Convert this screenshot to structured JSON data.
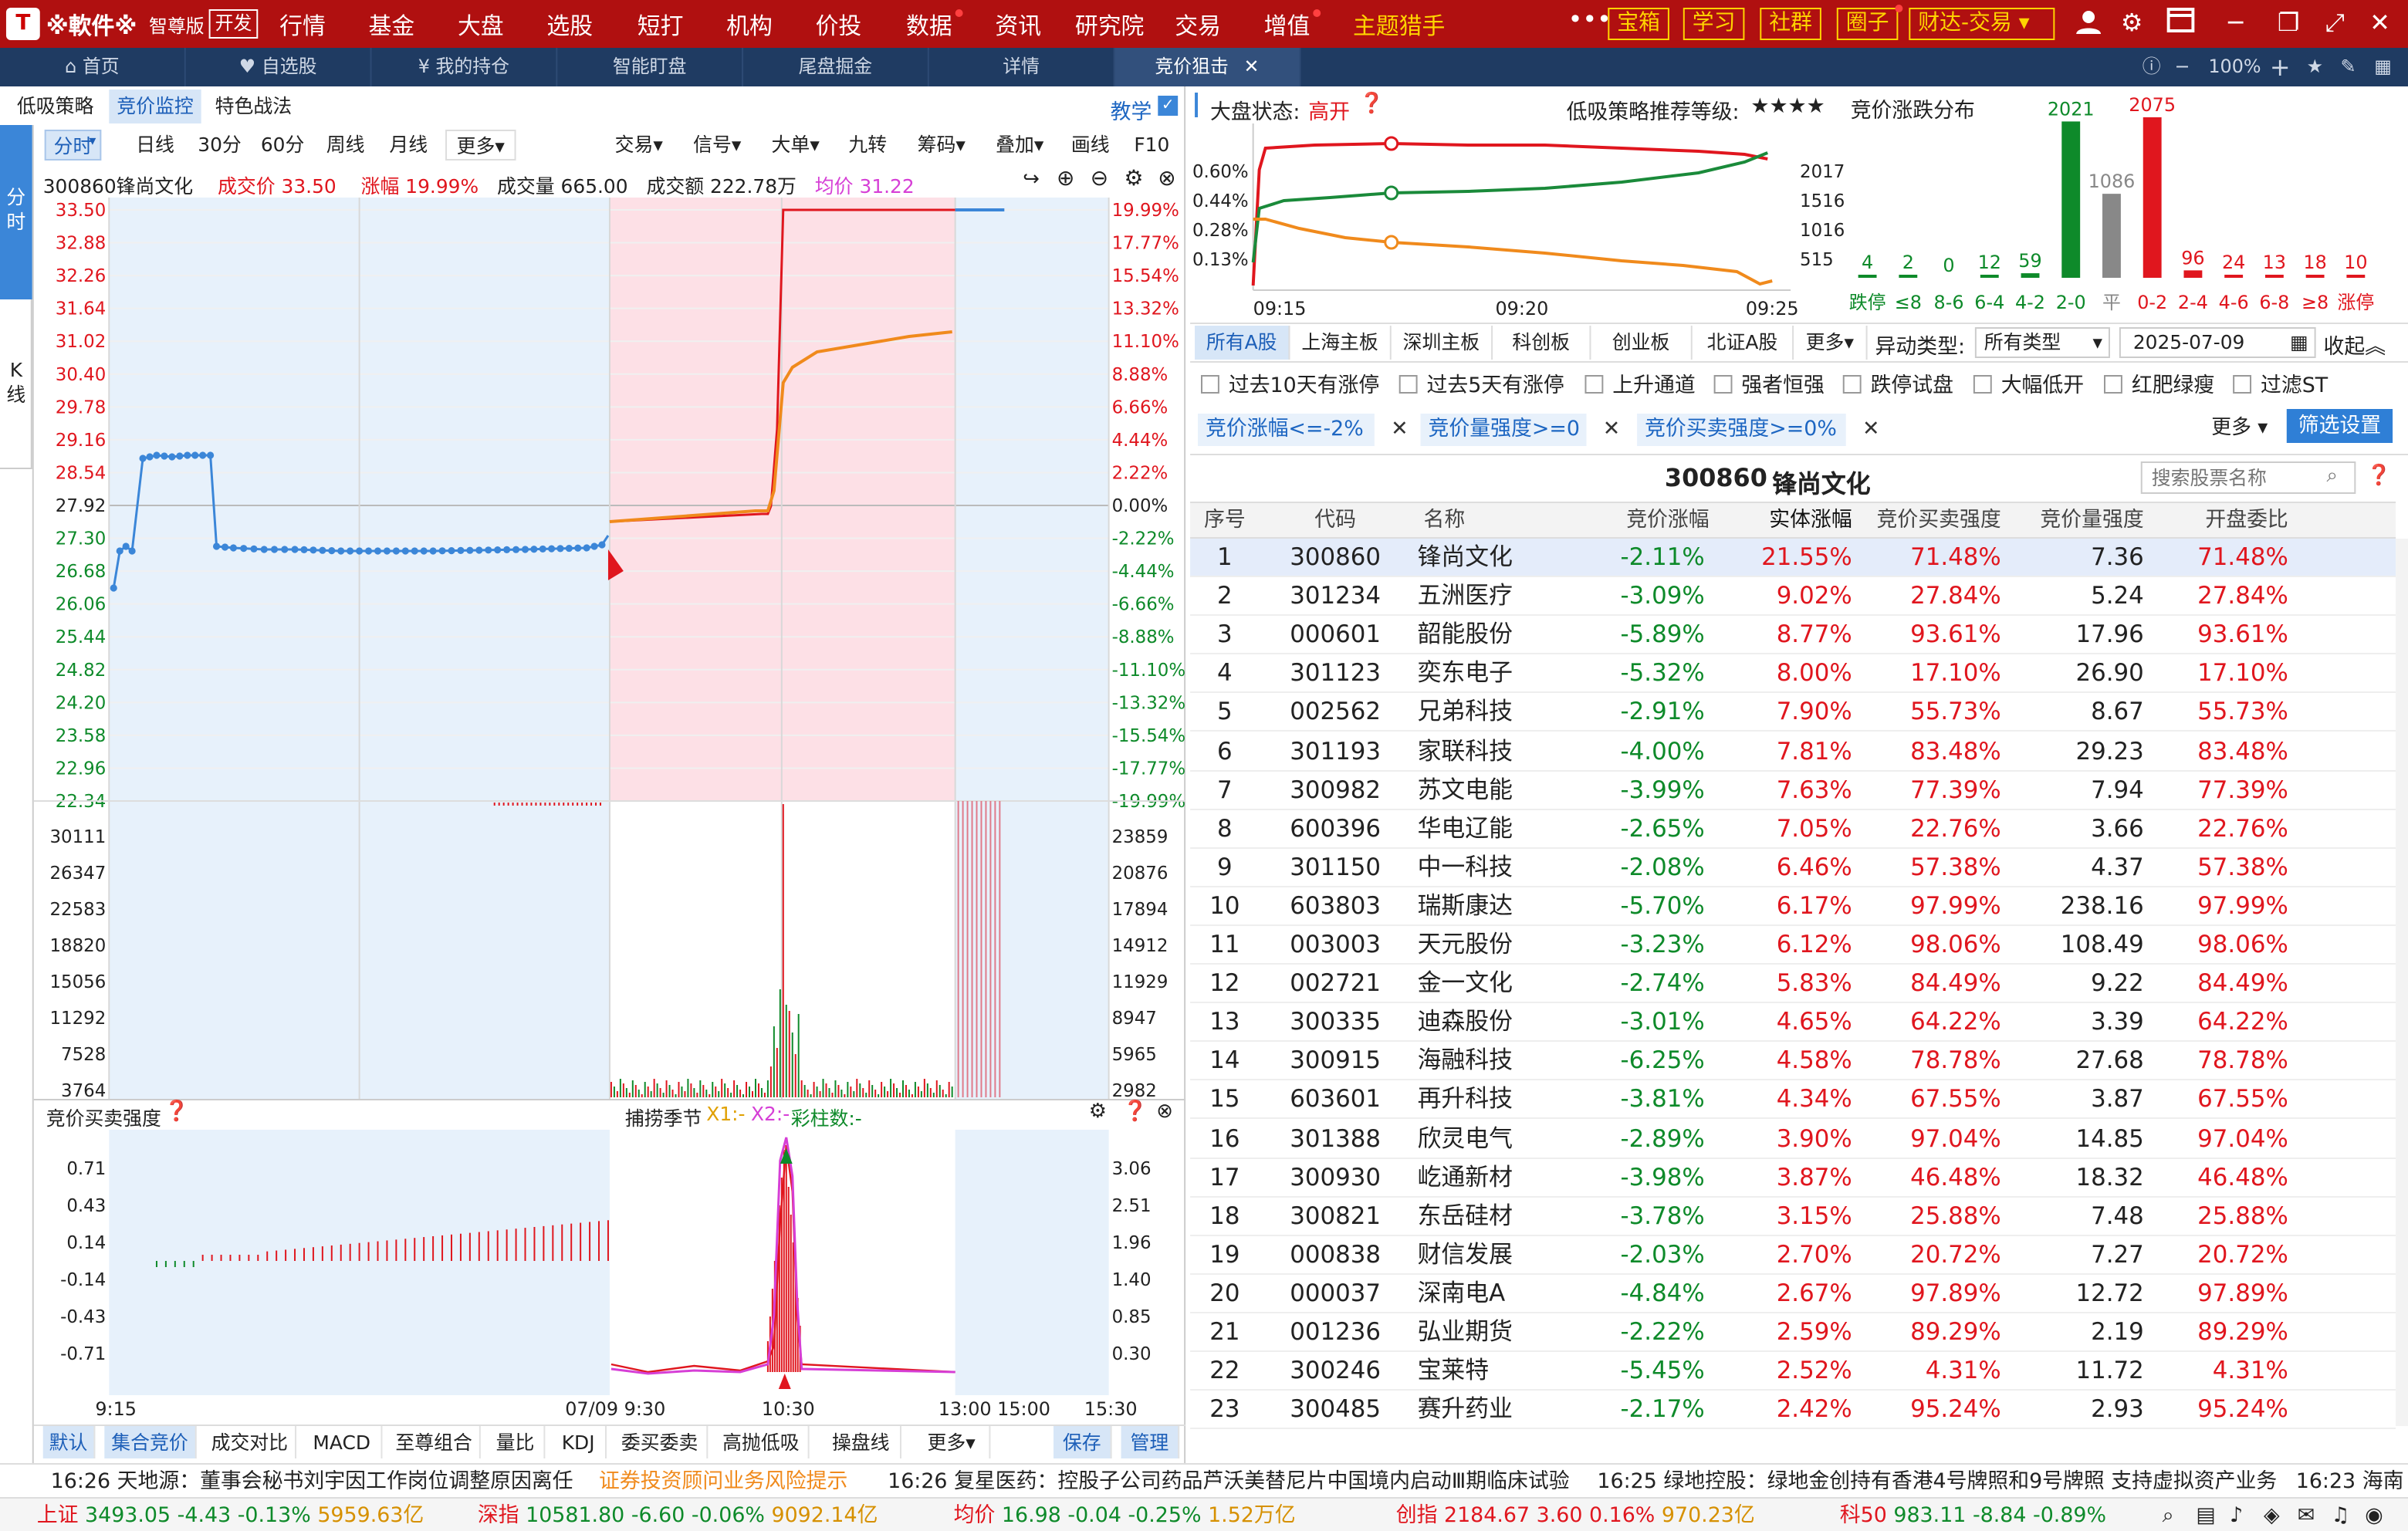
{
  "topbar": {
    "brand": "※軟件※",
    "edition": "智尊版",
    "dev": "开发",
    "menu": [
      "行情",
      "基金",
      "大盘",
      "选股",
      "短打",
      "机构",
      "价投",
      "数据",
      "资讯",
      "研究院",
      "交易",
      "增值"
    ],
    "theme": "主题猎手",
    "boxes": [
      "宝箱",
      "学习",
      "社群",
      "圈子",
      "财达-交易"
    ]
  },
  "tabs": [
    "首页",
    "自选股",
    "我的持仓",
    "智能盯盘",
    "尾盘掘金",
    "详情",
    "竞价狙击"
  ],
  "zoom": "100%",
  "left": {
    "subtabs": [
      "低吸策略",
      "竞价监控",
      "特色战法"
    ],
    "teach": "教学",
    "chart_tabs": [
      "分时",
      "日线",
      "30分",
      "60分",
      "周线",
      "月线",
      "更多"
    ],
    "chart_tabs_right": [
      "交易",
      "信号",
      "大单",
      "九转",
      "筹码",
      "叠加",
      "画线",
      "F10"
    ],
    "vtabs": [
      "分时",
      "K线"
    ],
    "info": {
      "stock": "300860锋尚文化",
      "price_label": "成交价",
      "price": "33.50",
      "chg_label": "涨幅",
      "chg": "19.99%",
      "vol_label": "成交量",
      "vol": "665.00",
      "amt_label": "成交额",
      "amt": "222.78万",
      "avg_label": "均价",
      "avg": "31.22"
    },
    "price_ticks": [
      "33.50",
      "32.88",
      "32.26",
      "31.64",
      "31.02",
      "30.40",
      "29.78",
      "29.16",
      "28.54",
      "27.92",
      "27.30",
      "26.68",
      "26.06",
      "25.44",
      "24.82",
      "24.20",
      "23.58",
      "22.96",
      "22.34"
    ],
    "pct_ticks": [
      "19.99%",
      "17.77%",
      "15.54%",
      "13.32%",
      "11.10%",
      "8.88%",
      "6.66%",
      "4.44%",
      "2.22%",
      "0.00%",
      "-2.22%",
      "-4.44%",
      "-6.66%",
      "-8.88%",
      "-11.10%",
      "-13.32%",
      "-15.54%",
      "-17.77%",
      "-19.99%"
    ],
    "vol_ticks_left": [
      "30111",
      "26347",
      "22583",
      "18820",
      "15056",
      "11292",
      "7528",
      "3764"
    ],
    "vol_ticks_right": [
      "23859",
      "20876",
      "17894",
      "14912",
      "11929",
      "8947",
      "5965",
      "2982"
    ],
    "ind_title": "竞价买卖强度",
    "ind_mid": "捕捞季节",
    "ind_x1": "X1:-",
    "ind_x2": "X2:-",
    "ind_bars": "彩柱数:-",
    "ind_ticks_left": [
      "0.71",
      "0.43",
      "0.14",
      "-0.14",
      "-0.43",
      "-0.71"
    ],
    "ind_ticks_right": [
      "3.06",
      "2.51",
      "1.96",
      "1.40",
      "0.85",
      "0.30"
    ],
    "time_labels": [
      "9:15",
      "07/09 9:30",
      "10:30",
      "13:00 15:00",
      "15:30"
    ],
    "bottom_tabs": [
      "默认",
      "集合竞价",
      "成交对比",
      "MACD",
      "至尊组合",
      "量比",
      "KDJ",
      "委买委卖",
      "高抛低吸",
      "操盘线",
      "更多"
    ],
    "save": "保存",
    "manage": "管理"
  },
  "right": {
    "status_label": "大盘状态:",
    "status": "高开",
    "grade_label": "低吸策略推荐等级:",
    "grade": "★★★★",
    "mini_left": [
      "0.60%",
      "0.44%",
      "0.28%",
      "0.13%"
    ],
    "mini_right": [
      "2017",
      "1516",
      "1016",
      "515"
    ],
    "mini_time": [
      "09:15",
      "09:20",
      "09:25"
    ],
    "dist_title": "竞价涨跌分布",
    "dist": {
      "labels": [
        "跌停",
        "≤8",
        "8-6",
        "6-4",
        "4-2",
        "2-0",
        "平",
        "0-2",
        "2-4",
        "4-6",
        "6-8",
        "≥8",
        "涨停"
      ],
      "values": [
        4,
        2,
        0,
        12,
        59,
        2021,
        1086,
        2075,
        96,
        24,
        13,
        18,
        10
      ]
    },
    "markets": [
      "所有A股",
      "上海主板",
      "深圳主板",
      "科创板",
      "创业板",
      "北证A股",
      "更多"
    ],
    "abn_label": "异动类型:",
    "abn_value": "所有类型",
    "date": "2025-07-09",
    "collapse": "收起",
    "checks": [
      "过去10天有涨停",
      "过去5天有涨停",
      "上升通道",
      "强者恒强",
      "跌停试盘",
      "大幅低开",
      "红肥绿瘦",
      "过滤ST"
    ],
    "filters": [
      "竞价涨幅<=-2%",
      "竞价量强度>=0",
      "竞价买卖强度>=0%"
    ],
    "more": "更多",
    "filter_btn": "筛选设置",
    "sel_code": "300860",
    "sel_name": "锋尚文化",
    "search_ph": "搜索股票名称",
    "columns": [
      "序号",
      "代码",
      "名称",
      "竞价涨幅",
      "实体涨幅",
      "竞价买卖强度",
      "竞价量强度",
      "开盘委比"
    ],
    "rows": [
      [
        "1",
        "300860",
        "锋尚文化",
        "-2.11%",
        "21.55%",
        "71.48%",
        "7.36",
        "71.48%"
      ],
      [
        "2",
        "301234",
        "五洲医疗",
        "-3.09%",
        "9.02%",
        "27.84%",
        "5.24",
        "27.84%"
      ],
      [
        "3",
        "000601",
        "韶能股份",
        "-5.89%",
        "8.77%",
        "93.61%",
        "17.96",
        "93.61%"
      ],
      [
        "4",
        "301123",
        "奕东电子",
        "-5.32%",
        "8.00%",
        "17.10%",
        "26.90",
        "17.10%"
      ],
      [
        "5",
        "002562",
        "兄弟科技",
        "-2.91%",
        "7.90%",
        "55.73%",
        "8.67",
        "55.73%"
      ],
      [
        "6",
        "301193",
        "家联科技",
        "-4.00%",
        "7.81%",
        "83.48%",
        "29.23",
        "83.48%"
      ],
      [
        "7",
        "300982",
        "苏文电能",
        "-3.99%",
        "7.63%",
        "77.39%",
        "7.94",
        "77.39%"
      ],
      [
        "8",
        "600396",
        "华电辽能",
        "-2.65%",
        "7.05%",
        "22.76%",
        "3.66",
        "22.76%"
      ],
      [
        "9",
        "301150",
        "中一科技",
        "-2.08%",
        "6.46%",
        "57.38%",
        "4.37",
        "57.38%"
      ],
      [
        "10",
        "603803",
        "瑞斯康达",
        "-5.70%",
        "6.17%",
        "97.99%",
        "238.16",
        "97.99%"
      ],
      [
        "11",
        "003003",
        "天元股份",
        "-3.23%",
        "6.12%",
        "98.06%",
        "108.49",
        "98.06%"
      ],
      [
        "12",
        "002721",
        "金一文化",
        "-2.74%",
        "5.83%",
        "84.49%",
        "9.22",
        "84.49%"
      ],
      [
        "13",
        "300335",
        "迪森股份",
        "-3.01%",
        "4.65%",
        "64.22%",
        "3.39",
        "64.22%"
      ],
      [
        "14",
        "300915",
        "海融科技",
        "-6.25%",
        "4.58%",
        "78.78%",
        "27.68",
        "78.78%"
      ],
      [
        "15",
        "603601",
        "再升科技",
        "-3.81%",
        "4.34%",
        "67.55%",
        "3.87",
        "67.55%"
      ],
      [
        "16",
        "301388",
        "欣灵电气",
        "-2.89%",
        "3.90%",
        "97.04%",
        "14.85",
        "97.04%"
      ],
      [
        "17",
        "300930",
        "屹通新材",
        "-3.98%",
        "3.87%",
        "46.48%",
        "18.32",
        "46.48%"
      ],
      [
        "18",
        "300821",
        "东岳硅材",
        "-3.78%",
        "3.15%",
        "25.88%",
        "7.48",
        "25.88%"
      ],
      [
        "19",
        "000838",
        "财信发展",
        "-2.03%",
        "2.70%",
        "20.72%",
        "7.27",
        "20.72%"
      ],
      [
        "20",
        "000037",
        "深南电A",
        "-4.84%",
        "2.67%",
        "97.89%",
        "12.72",
        "97.89%"
      ],
      [
        "21",
        "001236",
        "弘业期货",
        "-2.22%",
        "2.59%",
        "89.29%",
        "2.19",
        "89.29%"
      ],
      [
        "22",
        "300246",
        "宝莱特",
        "-5.45%",
        "2.52%",
        "4.31%",
        "11.72",
        "4.31%"
      ],
      [
        "23",
        "300485",
        "赛升药业",
        "-2.17%",
        "2.42%",
        "95.24%",
        "2.93",
        "95.24%"
      ]
    ]
  },
  "news": [
    {
      "time": "16:26",
      "text": "天地源：董事会秘书刘宇因工作岗位调整原因离任"
    },
    {
      "time": "",
      "text": "证券投资顾问业务风险提示"
    },
    {
      "time": "16:26",
      "text": "复星医药：控股子公司药品芦沃美替尼片中国境内启动Ⅲ期临床试验"
    },
    {
      "time": "16:25",
      "text": "绿地控股：绿地金创持有香港4号牌照和9号牌照 支持虚拟资产业务"
    },
    {
      "time": "16:23",
      "text": "海南"
    }
  ],
  "indices": [
    {
      "name": "上证",
      "value": "3493.05",
      "chg": "-4.43",
      "pct": "-0.13%",
      "amt": "5959.63亿"
    },
    {
      "name": "深指",
      "value": "10581.80",
      "chg": "-6.60",
      "pct": "-0.06%",
      "amt": "9092.14亿"
    },
    {
      "name": "均价",
      "value": "16.98",
      "chg": "-0.04",
      "pct": "-0.25%",
      "amt": "1.52万亿"
    },
    {
      "name": "创指",
      "value": "2184.67",
      "chg": "3.60",
      "pct": "0.16%",
      "amt": "970.23亿"
    },
    {
      "name": "科50",
      "value": "983.11",
      "chg": "-8.84",
      "pct": "-0.89%",
      "amt": ""
    }
  ],
  "colors": {
    "up": "#e0161e",
    "down": "#0e8a2a",
    "accent": "#1d66c2",
    "topbar": "#b01010"
  }
}
